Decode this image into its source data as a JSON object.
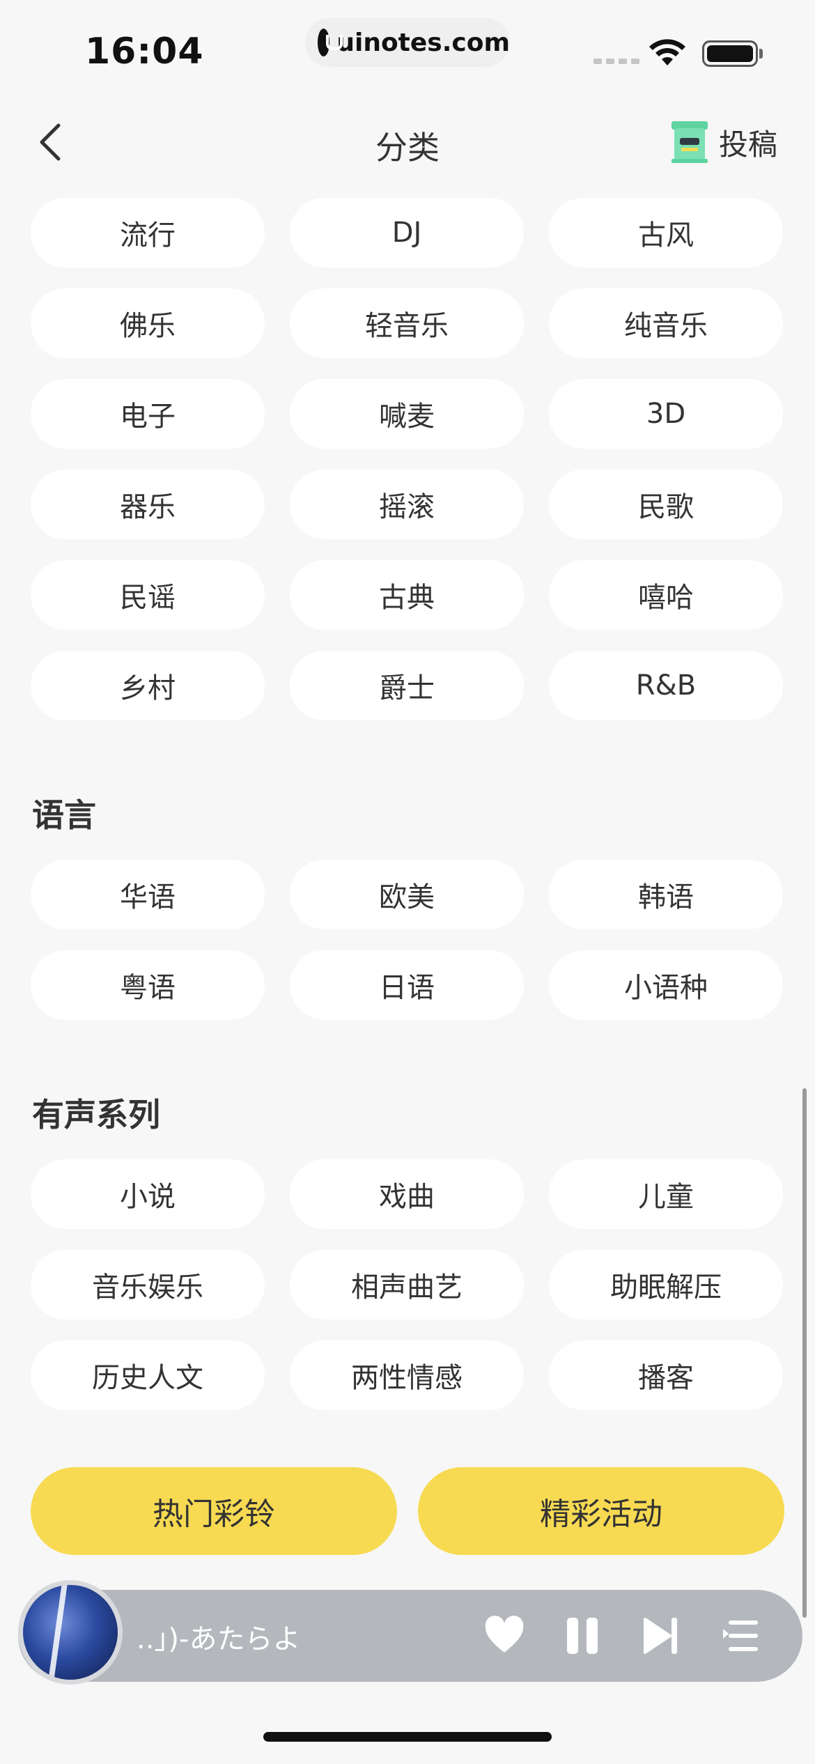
{
  "status_bar": {
    "time": "16:04",
    "url": "uinotes.com"
  },
  "nav": {
    "title": "分类",
    "submit_label": "投稿"
  },
  "genres": [
    [
      "流行",
      "DJ",
      "古风"
    ],
    [
      "佛乐",
      "轻音乐",
      "纯音乐"
    ],
    [
      "电子",
      "喊麦",
      "3D"
    ],
    [
      "器乐",
      "摇滚",
      "民歌"
    ],
    [
      "民谣",
      "古典",
      "嘻哈"
    ],
    [
      "乡村",
      "爵士",
      "R&B"
    ]
  ],
  "language": {
    "title": "语言",
    "items": [
      [
        "华语",
        "欧美",
        "韩语"
      ],
      [
        "粤语",
        "日语",
        "小语种"
      ]
    ]
  },
  "audio_series": {
    "title": "有声系列",
    "items": [
      [
        "小说",
        "戏曲",
        "儿童"
      ],
      [
        "音乐娱乐",
        "相声曲艺",
        "助眠解压"
      ],
      [
        "历史人文",
        "两性情感",
        "播客"
      ]
    ]
  },
  "actions": {
    "hot_ringtones": "热门彩铃",
    "events": "精彩活动"
  },
  "player": {
    "track": "..」)-あたらよ"
  },
  "colors": {
    "accent_yellow": "#f7da52",
    "background": "#f7f7f7",
    "chip": "#ffffff",
    "player_bar": "#b4b8bd",
    "mailbox_green": "#5fd3a0"
  }
}
